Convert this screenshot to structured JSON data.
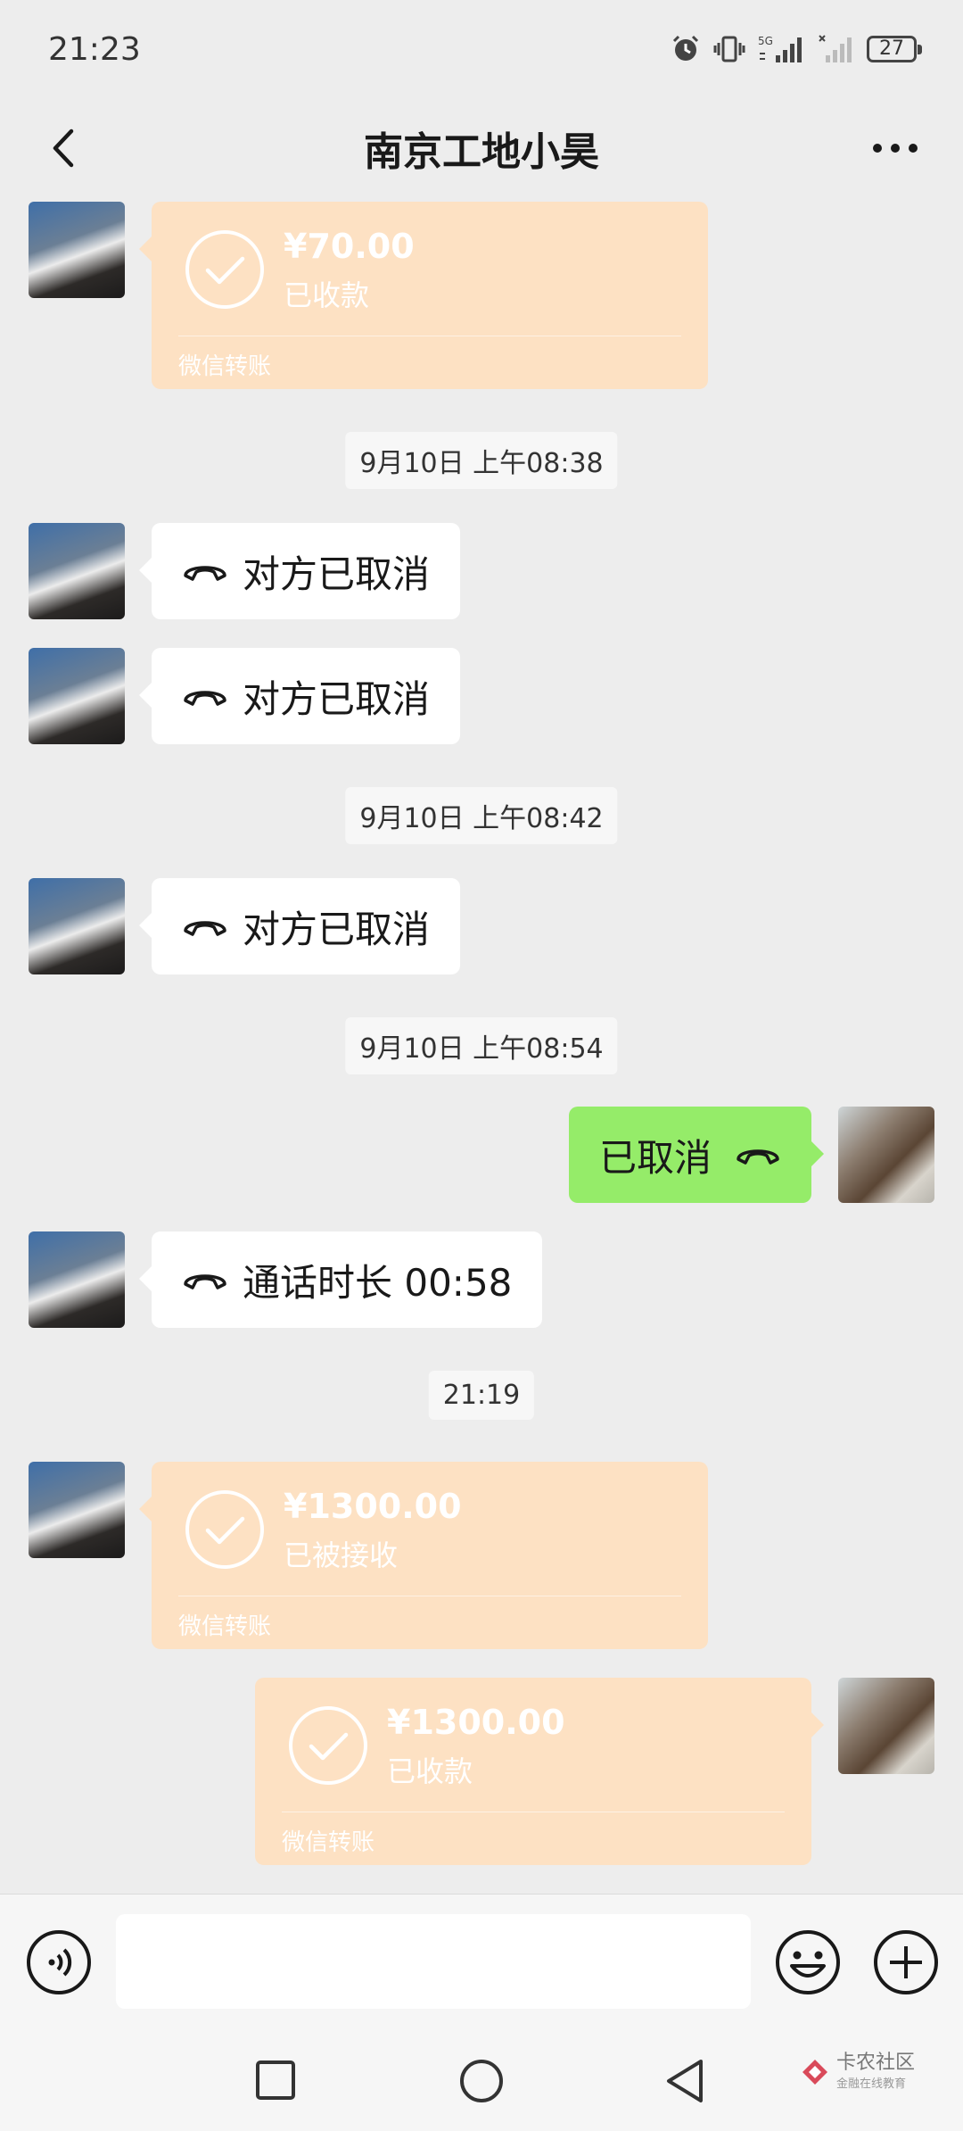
{
  "status_bar": {
    "time": "21:23",
    "battery": "27",
    "network": "5G",
    "icons": [
      "alarm-icon",
      "vibrate-icon",
      "signal-5g-icon",
      "signal-no-sim-icon",
      "battery-icon"
    ]
  },
  "header": {
    "title": "南京工地小昊",
    "back_icon": "chevron-left-icon",
    "more_icon": "more-icon"
  },
  "messages": [
    {
      "type": "transfer",
      "side": "other",
      "amount": "¥70.00",
      "status": "已收款",
      "label": "微信转账"
    },
    {
      "type": "time",
      "text": "9月10日 上午08:38"
    },
    {
      "type": "call",
      "side": "other",
      "text": "对方已取消"
    },
    {
      "type": "call",
      "side": "other",
      "text": "对方已取消"
    },
    {
      "type": "time",
      "text": "9月10日 上午08:42"
    },
    {
      "type": "call",
      "side": "other",
      "text": "对方已取消"
    },
    {
      "type": "time",
      "text": "9月10日 上午08:54"
    },
    {
      "type": "call",
      "side": "me",
      "text": "已取消"
    },
    {
      "type": "call",
      "side": "other",
      "text": "通话时长 00:58"
    },
    {
      "type": "time",
      "text": "21:19"
    },
    {
      "type": "transfer",
      "side": "other",
      "amount": "¥1300.00",
      "status": "已被接收",
      "label": "微信转账"
    },
    {
      "type": "transfer",
      "side": "me",
      "amount": "¥1300.00",
      "status": "已收款",
      "label": "微信转账"
    }
  ],
  "input_bar": {
    "value": "",
    "icons": [
      "voice-icon",
      "emoji-icon",
      "plus-icon"
    ]
  },
  "nav_bar": {
    "icons": [
      "recents-icon",
      "home-icon",
      "back-icon"
    ]
  },
  "watermark": {
    "title": "卡农社区",
    "subtitle": "金融在线教育"
  },
  "colors": {
    "background": "#ededed",
    "bubble_other": "#ffffff",
    "bubble_me": "#95ec69",
    "transfer": "#fde1c3"
  }
}
